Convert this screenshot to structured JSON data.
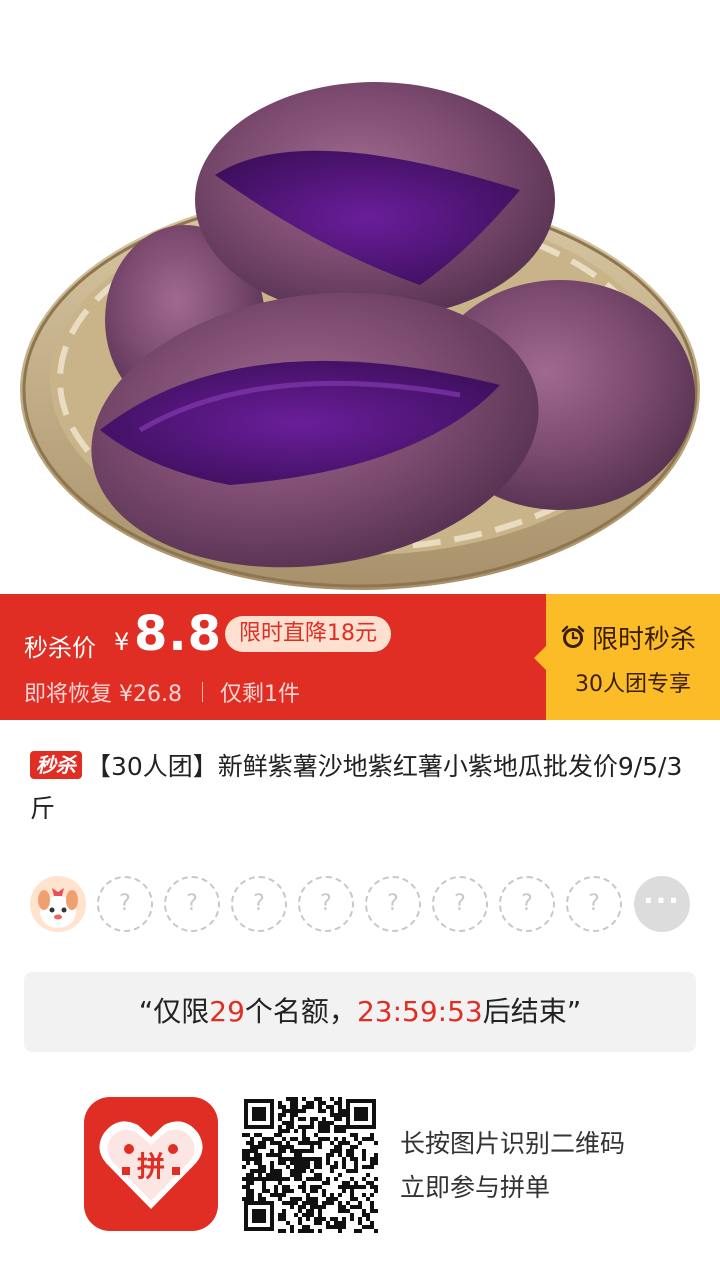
{
  "hero": {
    "image": "purple-sweet-potato-in-bamboo-basket"
  },
  "banner": {
    "price_label": "秒杀价",
    "currency": "¥",
    "price": "8.8",
    "drop_badge": "限时直降18元",
    "restore_text": "即将恢复 ¥26.8",
    "remain_text": "仅剩1件",
    "flash_title": "限时秒杀",
    "flash_sub": "30人团专享",
    "icons": {
      "clock": "alarm-clock-icon"
    },
    "colors": {
      "red": "#e02e24",
      "yellow": "#fbbc28",
      "badge_bg": "#fde0cf"
    }
  },
  "product": {
    "tag": "秒杀",
    "title": "【30人团】新鲜紫薯沙地紫红薯小紫地瓜批发价9/5/3斤"
  },
  "group": {
    "empty_slot_symbol": "?",
    "more_symbol": "···",
    "slots": [
      "?",
      "?",
      "?",
      "?",
      "?",
      "?",
      "?",
      "?"
    ]
  },
  "notice": {
    "prefix": "“仅限",
    "count": "29",
    "middle": "个名额，",
    "countdown": "23:59:53",
    "suffix": "后结束”"
  },
  "footer": {
    "hint_line1": "长按图片识别二维码",
    "hint_line2": "立即参与拼单",
    "logo_text": "拼"
  }
}
